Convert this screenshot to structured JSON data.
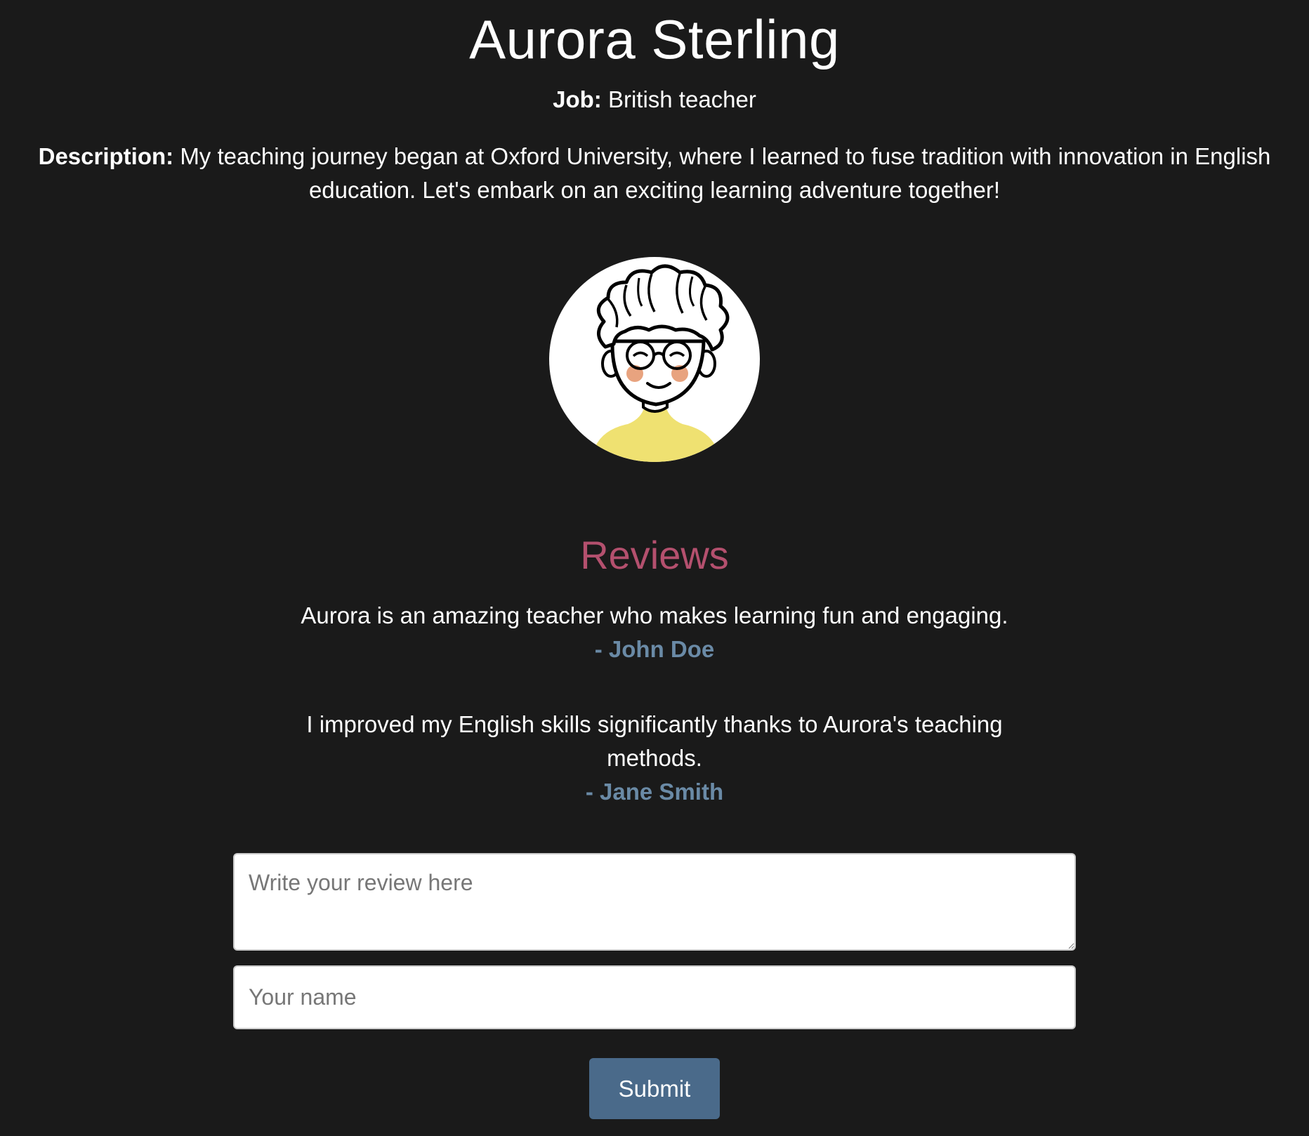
{
  "profile": {
    "name": "Aurora Sterling",
    "job_label": "Job:",
    "job_value": "British teacher",
    "description_label": "Description:",
    "description_value": "My teaching journey began at Oxford University, where I learned to fuse tradition with innovation in English education. Let's embark on an exciting learning adventure together!"
  },
  "avatar": {
    "icon": "teacher-avatar-illustration"
  },
  "reviews": {
    "heading": "Reviews",
    "items": [
      {
        "text": "Aurora is an amazing teacher who makes learning fun and engaging.",
        "author": "- John Doe"
      },
      {
        "text": "I improved my English skills significantly thanks to Aurora's teaching methods.",
        "author": "- Jane Smith"
      }
    ]
  },
  "form": {
    "review_placeholder": "Write your review here",
    "review_value": "",
    "name_placeholder": "Your name",
    "name_value": "",
    "submit_label": "Submit"
  },
  "colors": {
    "background": "#1a1a1a",
    "reviews_heading": "#b4506e",
    "review_author": "#6a8aa6",
    "submit_button": "#4a6a8a"
  }
}
